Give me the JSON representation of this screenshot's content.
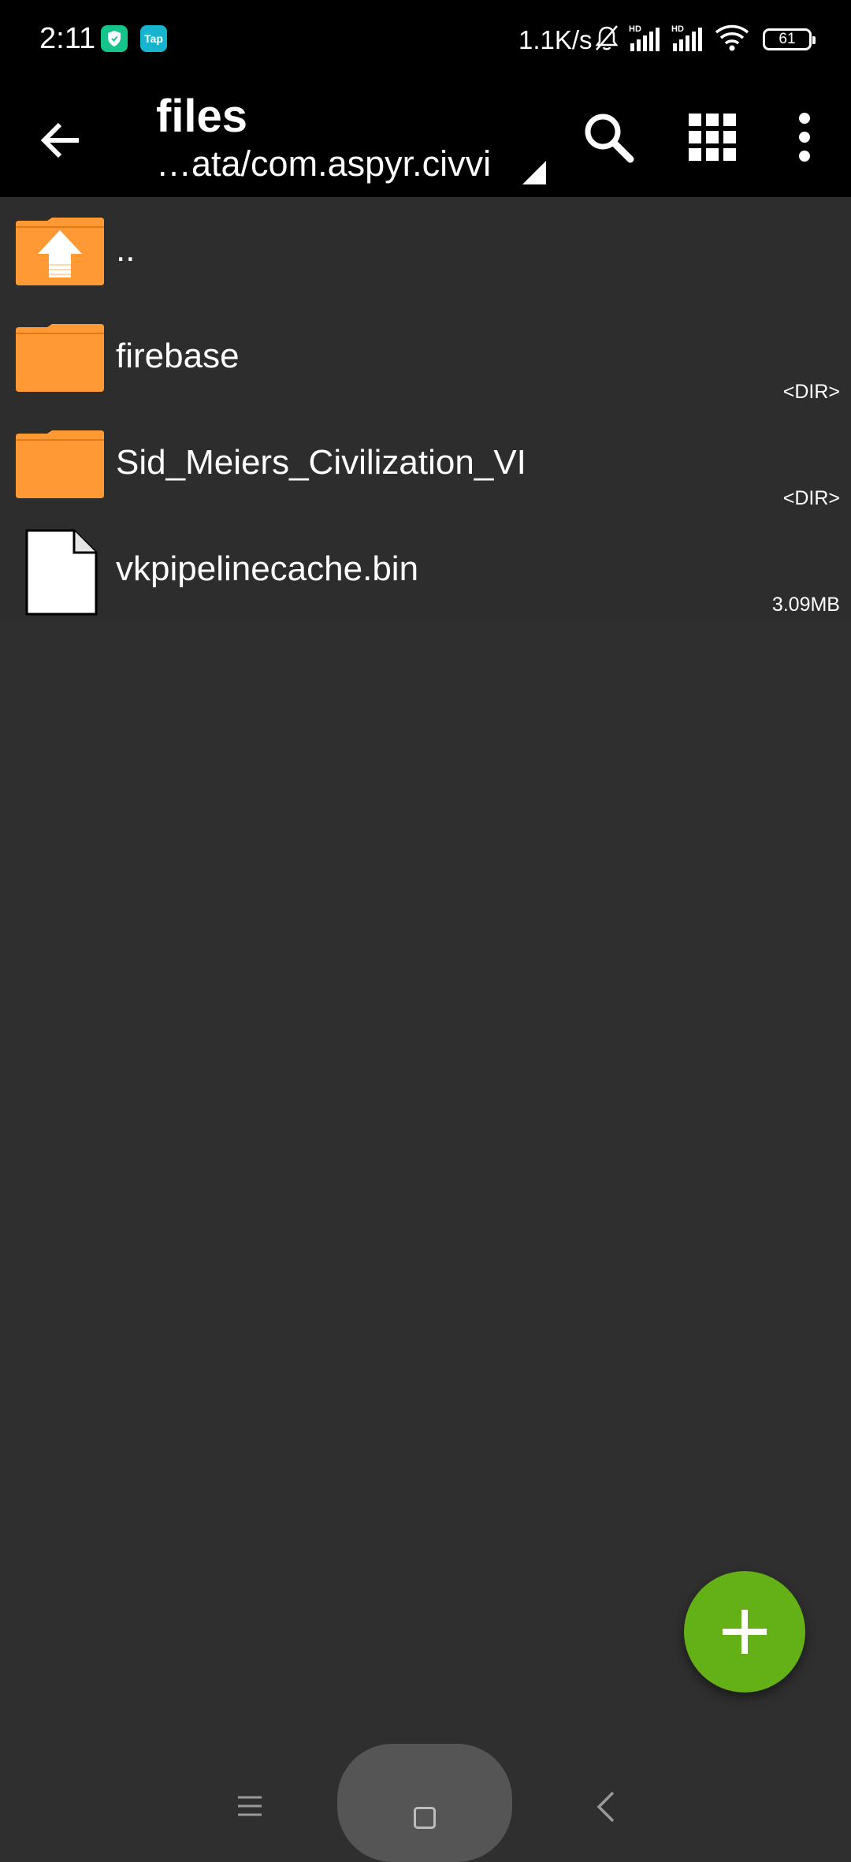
{
  "status_bar": {
    "time": "2:11",
    "tap_badge": "Tap",
    "network_speed": "1.1K/s",
    "battery": "61",
    "icons": [
      "shield-app-icon",
      "tap-app-icon",
      "mute-bell-icon",
      "hd-signal-icon",
      "hd-signal-icon",
      "wifi-icon",
      "battery-icon"
    ]
  },
  "toolbar": {
    "title": "files",
    "path": "…ata/com.aspyr.civvi",
    "icons": [
      "back-arrow-icon",
      "dropdown-triangle-icon",
      "search-icon",
      "grid-view-icon",
      "more-vert-icon"
    ]
  },
  "files": [
    {
      "name": "..",
      "meta": "",
      "type": "parent-folder"
    },
    {
      "name": "firebase",
      "meta": "<DIR>",
      "type": "folder"
    },
    {
      "name": "Sid_Meiers_Civilization_VI",
      "meta": "<DIR>",
      "type": "folder"
    },
    {
      "name": "vkpipelinecache.bin",
      "meta": "3.09MB",
      "type": "file"
    }
  ],
  "fab": {
    "icon": "plus-icon"
  },
  "nav_bar": {
    "icons": [
      "menu-icon",
      "home-icon",
      "back-icon"
    ]
  },
  "colors": {
    "folder": "#ff9933",
    "fab": "#64b017",
    "background": "#2f2f2f",
    "bars": "#000000"
  }
}
